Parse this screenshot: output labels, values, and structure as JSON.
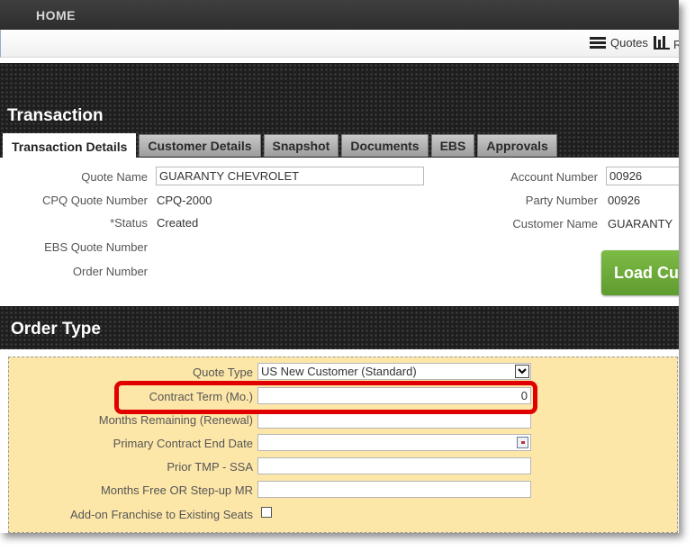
{
  "topbar": {
    "home": "HOME"
  },
  "subbar": {
    "quotes": "Quotes",
    "reports_partial": "R"
  },
  "transaction": {
    "title": "Transaction",
    "tabs": [
      "Transaction Details",
      "Customer Details",
      "Snapshot",
      "Documents",
      "EBS",
      "Approvals"
    ],
    "fields": {
      "quote_name_label": "Quote Name",
      "quote_name_value": "GUARANTY CHEVROLET",
      "cpq_label": "CPQ Quote Number",
      "cpq_value": "CPQ-2000",
      "status_label": "*Status",
      "status_value": "Created",
      "ebs_label": "EBS Quote Number",
      "order_label": "Order Number",
      "account_label": "Account Number",
      "account_value": "00926",
      "party_label": "Party Number",
      "party_value": "00926",
      "customer_label": "Customer Name",
      "customer_value": "GUARANTY"
    },
    "load_button": "Load Cu"
  },
  "order_type": {
    "title": "Order Type",
    "quote_type_label": "Quote Type",
    "quote_type_value": "US New Customer (Standard)",
    "contract_term_label": "Contract Term (Mo.)",
    "contract_term_value": "0",
    "months_remaining_label": "Months Remaining (Renewal)",
    "primary_end_label": "Primary Contract End Date",
    "prior_tmp_label": "Prior TMP - SSA",
    "months_free_label": "Months Free OR Step-up MR",
    "addon_label": "Add-on Franchise to Existing Seats"
  },
  "colors": {
    "highlight": "#e00000",
    "form_background": "#fde7a8",
    "load_button": "#6aab38"
  }
}
